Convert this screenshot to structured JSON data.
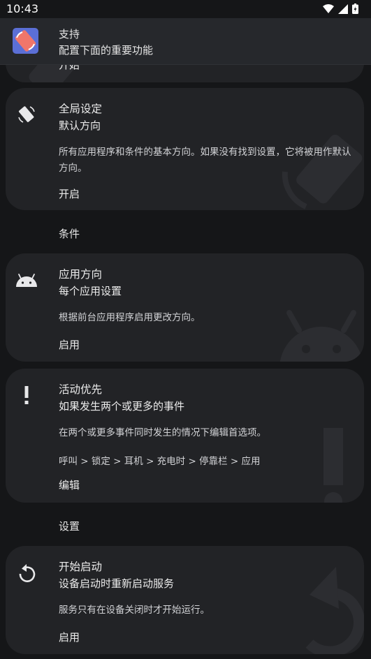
{
  "status_bar": {
    "time": "10:43"
  },
  "header": {
    "title": "支持",
    "subtitle": "配置下面的重要功能"
  },
  "previous_card": {
    "action": "开始"
  },
  "cards": [
    {
      "title": "全局设定",
      "subtitle": "默认方向",
      "description": "所有应用程序和条件的基本方向。如果没有找到设置，它将被用作默认方向。",
      "action": "开启",
      "icon": "rotate-device-icon"
    },
    {
      "title": "应用方向",
      "subtitle": "每个应用设置",
      "description": "根据前台应用程序启用更改方向。",
      "action": "启用",
      "icon": "android-icon"
    },
    {
      "title": "活动优先",
      "subtitle": "如果发生两个或更多的事件",
      "description": "在两个或更多事件同时发生的情况下编辑首选项。",
      "priority_order": "呼叫 > 锁定 > 耳机 > 充电时 > 停靠栏 > 应用",
      "action": "编辑",
      "icon": "exclamation-icon"
    },
    {
      "title": "开始启动",
      "subtitle": "设备启动时重新启动服务",
      "description": "服务只有在设备关闭时才开始运行。",
      "action": "启用",
      "icon": "restart-icon"
    }
  ],
  "sections": {
    "conditions": "条件",
    "settings": "设置"
  },
  "colors": {
    "background": "#151618",
    "card": "#222326",
    "header": "#26282c",
    "app_icon": "#5b6fd6",
    "app_icon_accent": "#f0766a"
  }
}
